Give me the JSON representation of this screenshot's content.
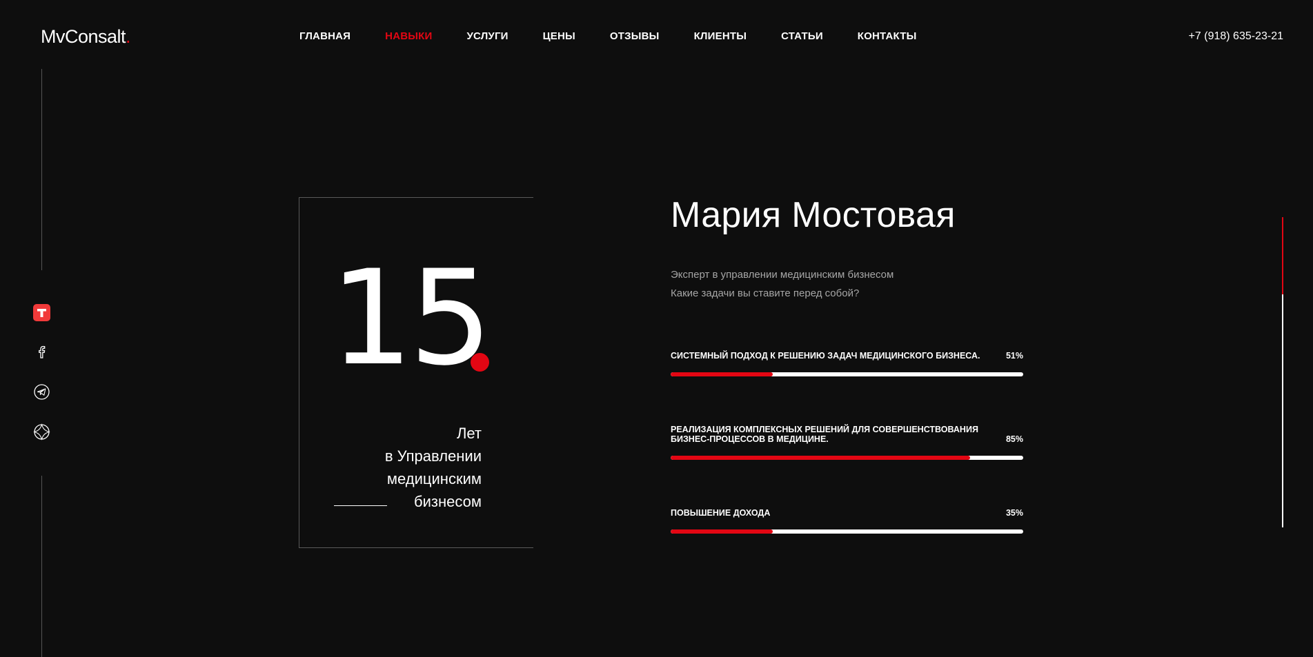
{
  "header": {
    "logo": "MvConsalt",
    "logo_dot": ".",
    "nav": [
      {
        "label": "ГЛАВНАЯ",
        "active": false
      },
      {
        "label": "НАВЫКИ",
        "active": true
      },
      {
        "label": "УСЛУГИ",
        "active": false
      },
      {
        "label": "ЦЕНЫ",
        "active": false
      },
      {
        "label": "ОТЗЫВЫ",
        "active": false
      },
      {
        "label": "КЛИЕНТЫ",
        "active": false
      },
      {
        "label": "СТАТЬИ",
        "active": false
      },
      {
        "label": "КОНТАКТЫ",
        "active": false
      }
    ],
    "phone": "+7 (918) 635-23-21"
  },
  "social": [
    {
      "icon": "tenchat-icon"
    },
    {
      "icon": "facebook-icon"
    },
    {
      "icon": "telegram-icon"
    },
    {
      "icon": "globe-icon"
    }
  ],
  "experience": {
    "number": "15",
    "caption": [
      "Лет",
      "в Управлении",
      "медицинским",
      "бизнесом"
    ]
  },
  "profile": {
    "name": "Мария Мостовая",
    "subtitle1": "Эксперт в управлении медицинским бизнесом",
    "subtitle2": "Какие задачи вы ставите перед собой?"
  },
  "skills": [
    {
      "label": "СИСТЕМНЫЙ ПОДХОД К РЕШЕНИЮ ЗАДАЧ МЕДИЦИНСКОГО БИЗНЕСА.",
      "value_text": "51%",
      "value": 0.29
    },
    {
      "label": "РЕАЛИЗАЦИЯ КОМПЛЕКСНЫХ РЕШЕНИЙ ДЛЯ СОВЕРШЕНСТВОВАНИЯ БИЗНЕС-ПРОЦЕССОВ В МЕДИЦИНЕ.",
      "value_text": "85%",
      "value": 0.85
    },
    {
      "label": "ПОВЫШЕНИЕ ДОХОДА",
      "value_text": "35%",
      "value": 0.29
    }
  ],
  "colors": {
    "accent": "#e30613",
    "background": "#0e0e0e"
  }
}
